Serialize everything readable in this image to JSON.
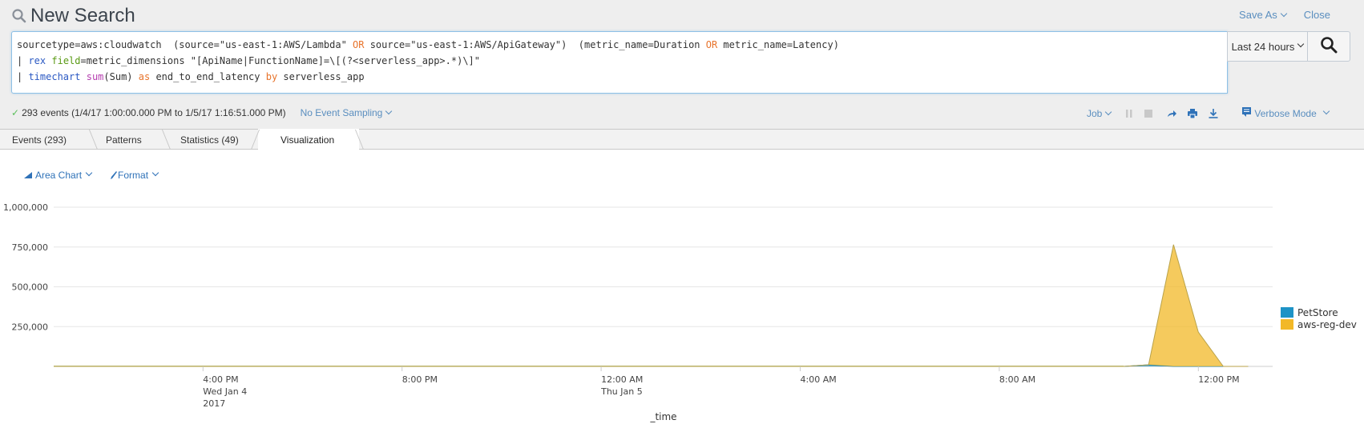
{
  "header": {
    "title": "New Search",
    "save_as": "Save As",
    "close": "Close"
  },
  "search": {
    "lines": [
      [
        {
          "t": "sourcetype=aws:cloudwatch  (source=\"us-east-1:AWS/Lambda\" ",
          "c": ""
        },
        {
          "t": "OR",
          "c": "kw-or"
        },
        {
          "t": " source=\"us-east-1:AWS/ApiGateway\")  (metric_name=Duration ",
          "c": ""
        },
        {
          "t": "OR",
          "c": "kw-or"
        },
        {
          "t": " metric_name=Latency)",
          "c": ""
        }
      ],
      [
        {
          "t": "| ",
          "c": ""
        },
        {
          "t": "rex",
          "c": "kw-cmd"
        },
        {
          "t": " ",
          "c": ""
        },
        {
          "t": "field",
          "c": "kw-arg"
        },
        {
          "t": "=metric_dimensions \"[ApiName|FunctionName]=\\[(?<serverless_app>.*)\\]\"",
          "c": ""
        }
      ],
      [
        {
          "t": "| ",
          "c": ""
        },
        {
          "t": "timechart",
          "c": "kw-cmd"
        },
        {
          "t": " ",
          "c": ""
        },
        {
          "t": "sum",
          "c": "kw-fn"
        },
        {
          "t": "(Sum) ",
          "c": ""
        },
        {
          "t": "as",
          "c": "kw-as"
        },
        {
          "t": " end_to_end_latency ",
          "c": ""
        },
        {
          "t": "by",
          "c": "kw-as"
        },
        {
          "t": " serverless_app",
          "c": ""
        }
      ]
    ],
    "time_range": "Last 24 hours",
    "search_icon": "search-icon"
  },
  "status": {
    "summary": "293 events (1/4/17 1:00:00.000 PM to 1/5/17 1:16:51.000 PM)",
    "sampling": "No Event Sampling",
    "job": "Job",
    "mode": "Verbose Mode"
  },
  "tabs": [
    {
      "label": "Events (293)",
      "active": false
    },
    {
      "label": "Patterns",
      "active": false
    },
    {
      "label": "Statistics (49)",
      "active": false
    },
    {
      "label": "Visualization",
      "active": true
    }
  ],
  "viz_toolbar": {
    "chart_type": "Area Chart",
    "format": "Format"
  },
  "chart_data": {
    "type": "area",
    "stacked": true,
    "xlabel": "_time",
    "ylabel": "",
    "ylim": [
      0,
      1000000
    ],
    "y_ticks": [
      "1,000,000",
      "750,000",
      "500,000",
      "250,000"
    ],
    "y_tick_values": [
      1000000,
      750000,
      500000,
      250000
    ],
    "x_range_hours": [
      0,
      24.25
    ],
    "x_ticks": [
      {
        "h": 3,
        "lines": [
          "4:00 PM",
          "Wed Jan 4",
          "2017"
        ]
      },
      {
        "h": 7,
        "lines": [
          "8:00 PM"
        ]
      },
      {
        "h": 11,
        "lines": [
          "12:00 AM",
          "Thu Jan 5"
        ]
      },
      {
        "h": 15,
        "lines": [
          "4:00 AM"
        ]
      },
      {
        "h": 19,
        "lines": [
          "8:00 AM"
        ]
      },
      {
        "h": 23,
        "lines": [
          "12:00 PM"
        ]
      }
    ],
    "x_hours_note": "hours since 1/4/17 1:00 PM",
    "x": [
      0,
      21.5,
      22,
      22.5,
      23,
      23.5,
      24
    ],
    "series": [
      {
        "name": "PetStore",
        "color": "#1e93c6",
        "values": [
          0,
          0,
          10000,
          0,
          0,
          0,
          0
        ]
      },
      {
        "name": "aws-reg-dev",
        "color": "#f2b827",
        "values": [
          0,
          0,
          0,
          765000,
          215000,
          0,
          0
        ]
      }
    ],
    "legend": "right"
  }
}
